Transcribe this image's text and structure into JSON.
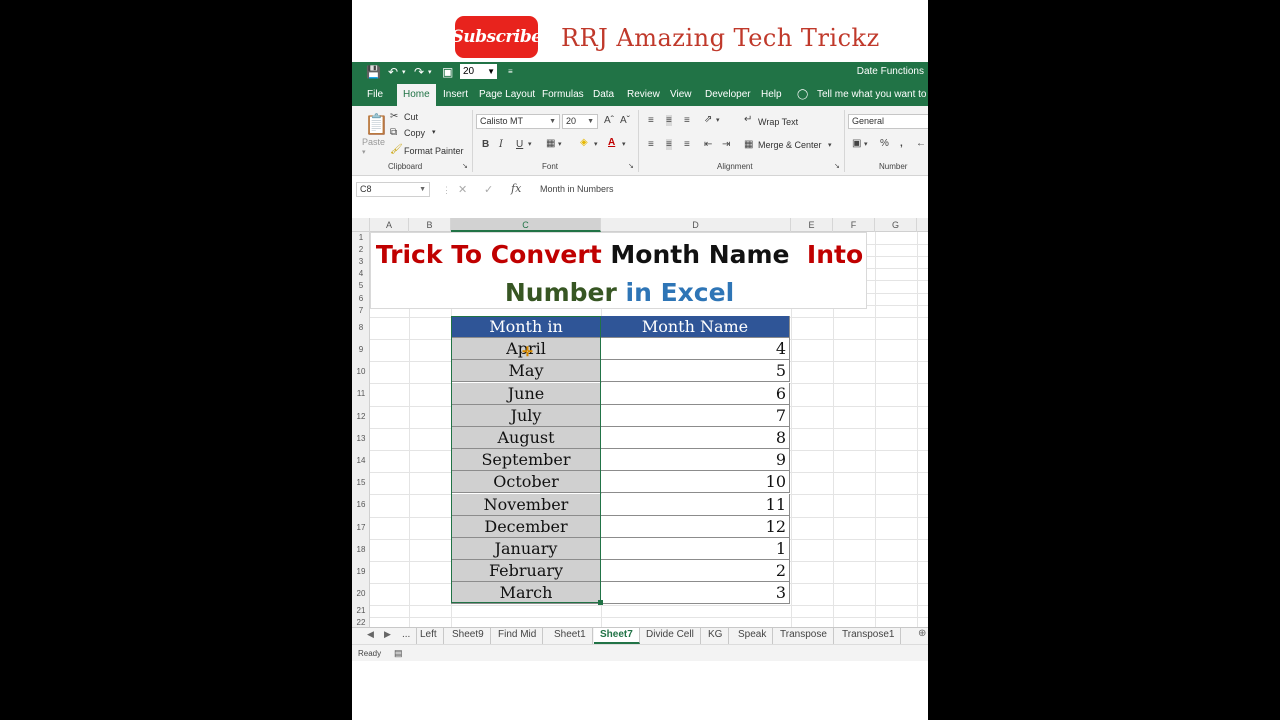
{
  "banner": {
    "subscribe_label": "Subscribe",
    "channel_name": "RRJ Amazing Tech Trickz"
  },
  "qat": {
    "font_size_value": "20",
    "document_title": "Date Functions"
  },
  "ribbon_tabs": [
    "File",
    "Home",
    "Insert",
    "Page Layout",
    "Formulas",
    "Data",
    "Review",
    "View",
    "Developer",
    "Help"
  ],
  "tell_me": "Tell me what you want to do",
  "ribbon": {
    "clipboard": {
      "paste": "Paste",
      "cut": "Cut",
      "copy": "Copy",
      "format_painter": "Format Painter",
      "label": "Clipboard"
    },
    "font": {
      "font_name": "Calisto MT",
      "font_size": "20",
      "label": "Font",
      "bold": "B",
      "italic": "I",
      "underline": "U"
    },
    "alignment": {
      "wrap_text": "Wrap Text",
      "merge_center": "Merge & Center",
      "label": "Alignment"
    },
    "number": {
      "format": "General",
      "label": "Number"
    }
  },
  "formula_bar": {
    "name_box": "C8",
    "content": "Month in Numbers"
  },
  "grid": {
    "columns": [
      "A",
      "B",
      "C",
      "D",
      "E",
      "F",
      "G"
    ],
    "rows": [
      "1",
      "2",
      "3",
      "4",
      "5",
      "6",
      "7",
      "8",
      "9",
      "10",
      "11",
      "12",
      "13",
      "14",
      "15",
      "16",
      "17",
      "18",
      "19",
      "20",
      "21",
      "22"
    ]
  },
  "title_card": {
    "line1_part1": "Trick To Convert",
    "line1_part2": "Month Name",
    "line1_part3": "Into",
    "line2_part1": "Number",
    "line2_part2": "in Excel"
  },
  "table": {
    "header_month": "Month in Numbers",
    "header_number": "Month Name",
    "rows": [
      {
        "month": "April",
        "number": "4"
      },
      {
        "month": "May",
        "number": "5"
      },
      {
        "month": "June",
        "number": "6"
      },
      {
        "month": "July",
        "number": "7"
      },
      {
        "month": "August",
        "number": "8"
      },
      {
        "month": "September",
        "number": "9"
      },
      {
        "month": "October",
        "number": "10"
      },
      {
        "month": "November",
        "number": "11"
      },
      {
        "month": "December",
        "number": "12"
      },
      {
        "month": "January",
        "number": "1"
      },
      {
        "month": "February",
        "number": "2"
      },
      {
        "month": "March",
        "number": "3"
      }
    ]
  },
  "sheet_tabs": [
    "...",
    "Left",
    "Sheet9",
    "Find Mid",
    "Sheet1",
    "Sheet7",
    "Divide Cell",
    "KG",
    "Speak",
    "Transpose",
    "Transpose1"
  ],
  "active_sheet": "Sheet7",
  "status": {
    "ready": "Ready"
  },
  "colors": {
    "excel_green": "#217346",
    "header_blue": "#2f5597",
    "title_red": "#c00000",
    "title_green": "#375623",
    "title_blue": "#2e75b6"
  }
}
